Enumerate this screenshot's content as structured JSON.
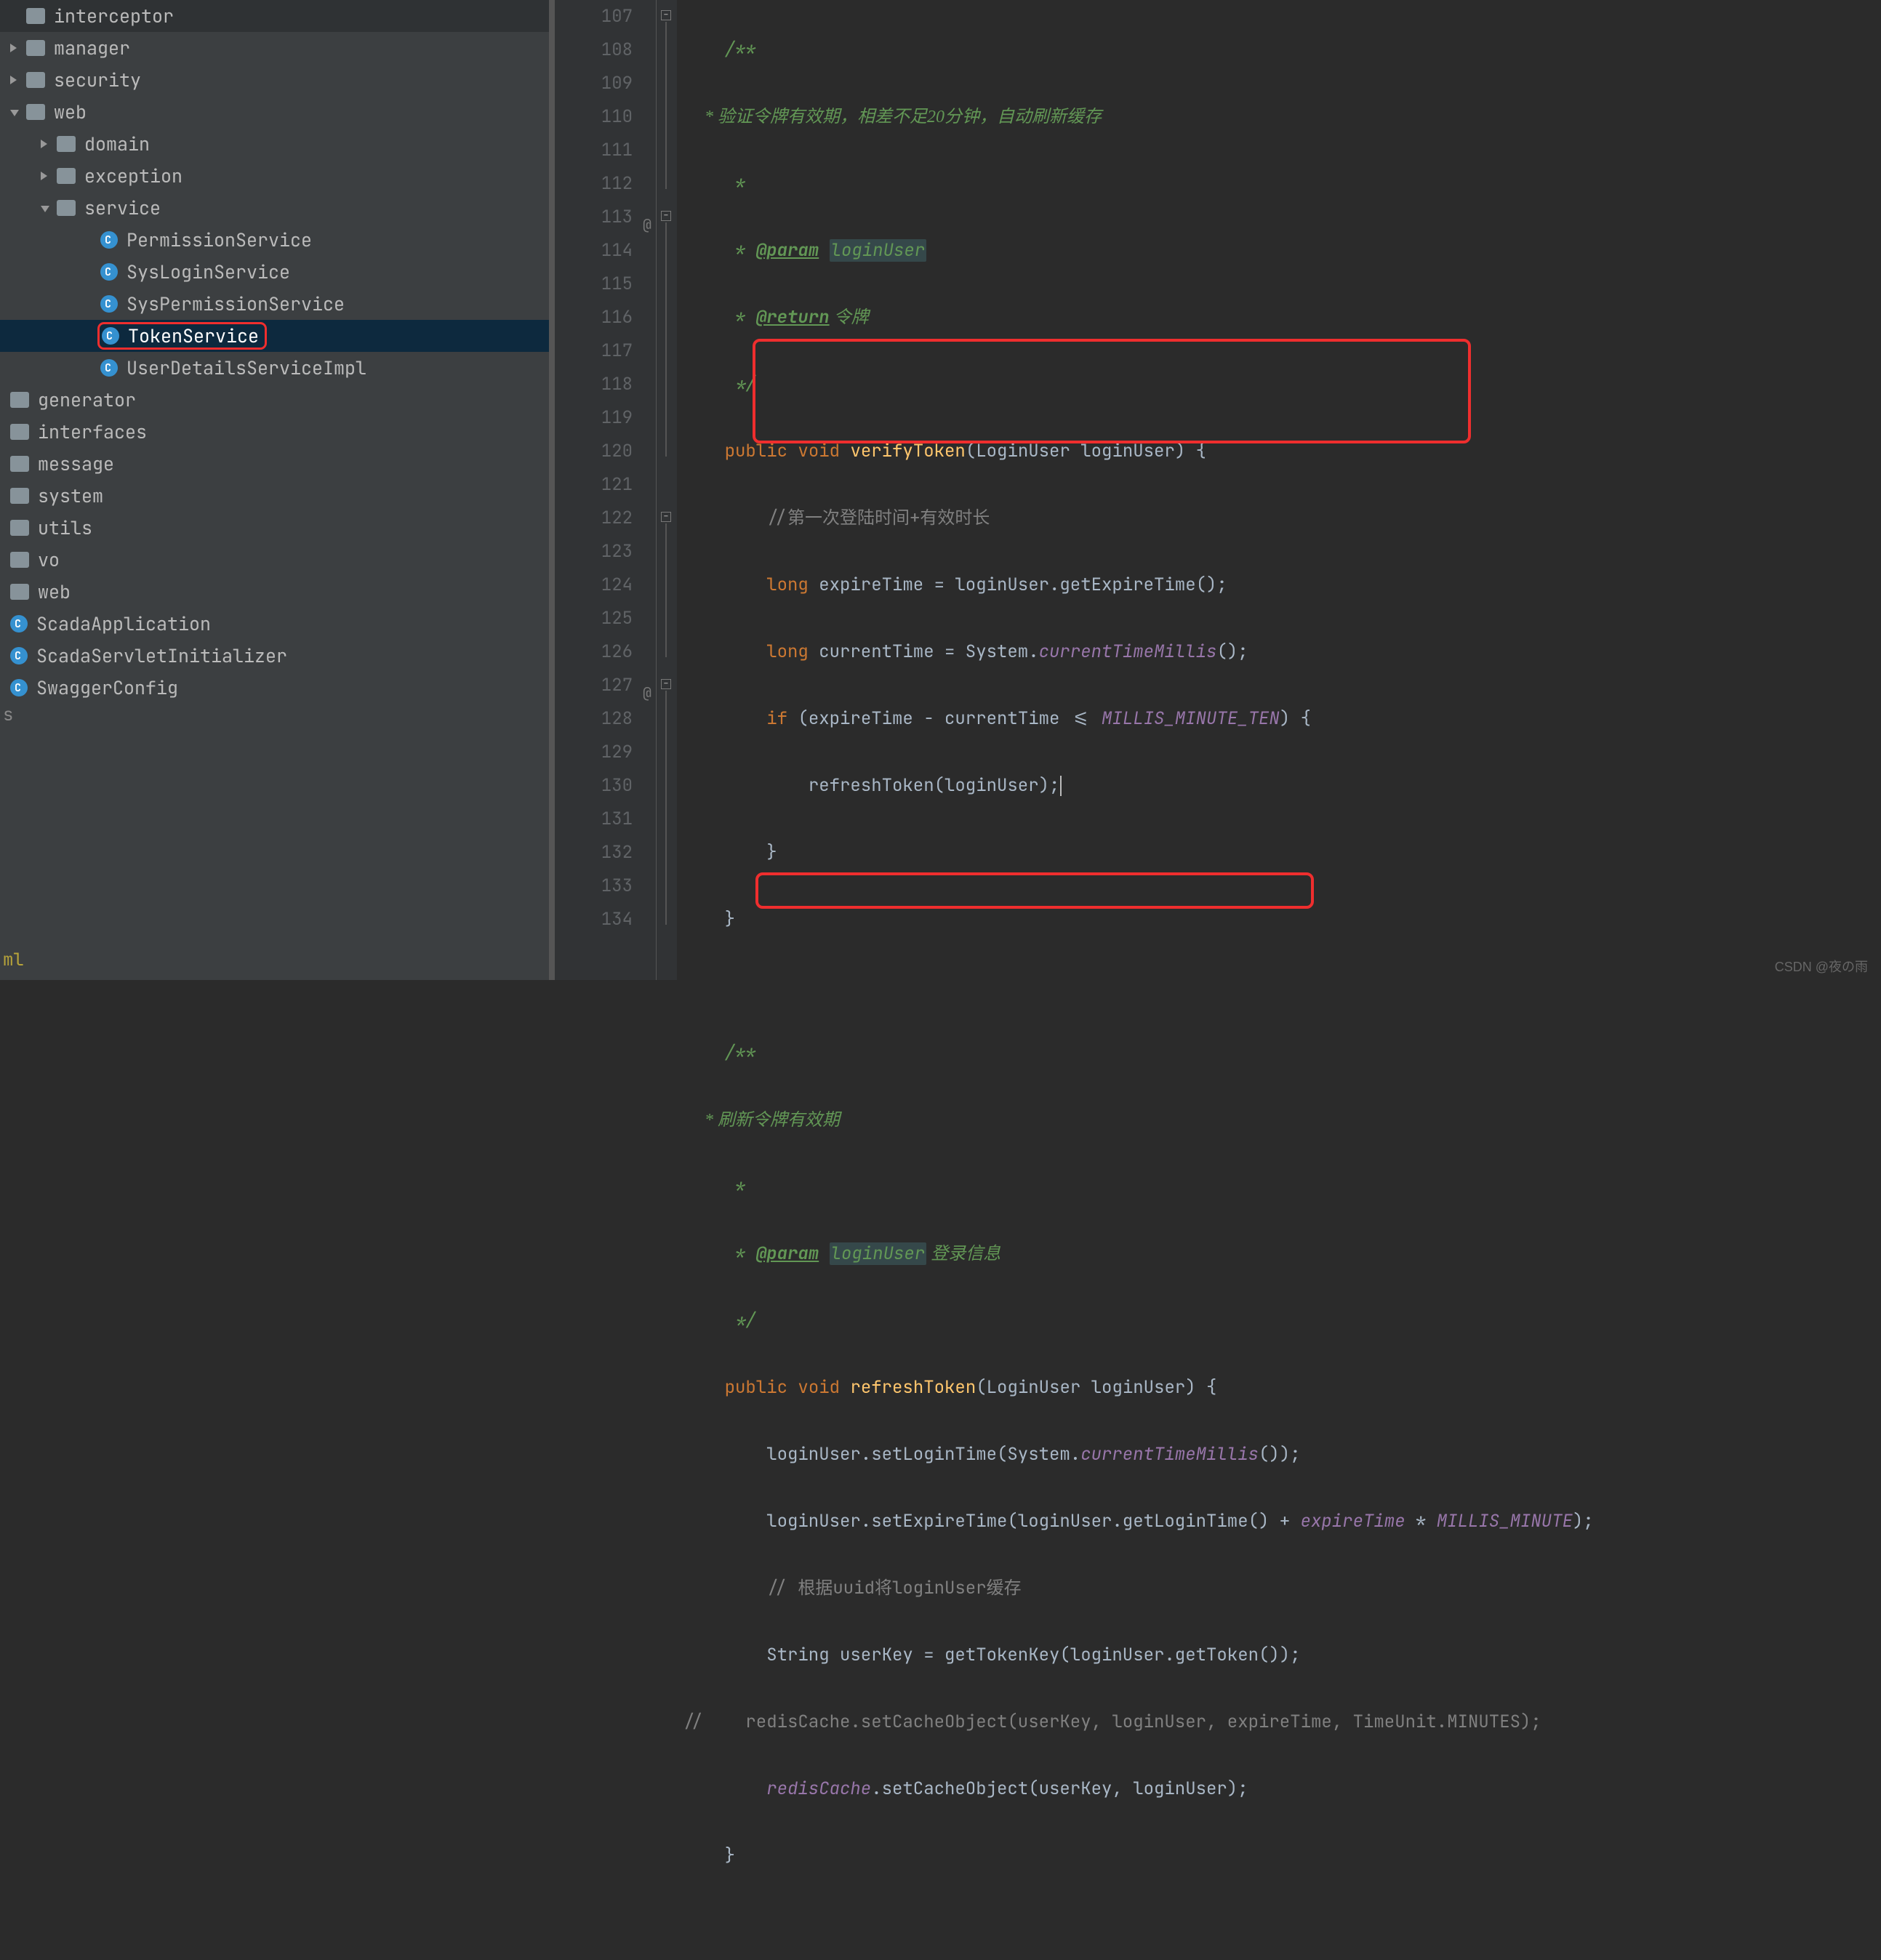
{
  "tree": {
    "l0": [
      "interceptor",
      "manager",
      "security",
      "web"
    ],
    "web_children_root": [
      "domain",
      "exception",
      "service"
    ],
    "service_children": [
      "PermissionService",
      "SysLoginService",
      "SysPermissionService",
      "TokenService",
      "UserDetailsServiceImpl"
    ],
    "l0b": [
      "generator",
      "interfaces",
      "message",
      "system",
      "utils",
      "vo",
      "web"
    ],
    "classes": [
      "ScadaApplication",
      "ScadaServletInitializer",
      "SwaggerConfig"
    ],
    "cut": "s",
    "ml": "ml"
  },
  "gutter": [
    "107",
    "108",
    "109",
    "110",
    "111",
    "112",
    "113",
    "114",
    "115",
    "116",
    "117",
    "118",
    "119",
    "120",
    "121",
    "122",
    "123",
    "124",
    "125",
    "126",
    "127",
    "128",
    "129",
    "130",
    "131",
    "132",
    "133",
    "134"
  ],
  "anno": {
    "113": "@",
    "127": "@"
  },
  "code": {
    "l107": "/**",
    "l108": " * 验证令牌有效期，相差不足20分钟，自动刷新缓存",
    "l109": " *",
    "l110_a": " * ",
    "l110_tag": "@param",
    "l110_b": " ",
    "l110_c": "loginUser",
    "l111_a": " * ",
    "l111_tag": "@return",
    "l111_b": " 令牌",
    "l112": " */",
    "l113_kw1": "public",
    "l113_kw2": "void",
    "l113_name": "verifyToken",
    "l113_sig": "(LoginUser loginUser) {",
    "l114": "//第一次登陆时间+有效时长",
    "l115_kw": "long",
    "l115_rest": " expireTime = loginUser.getExpireTime();",
    "l116_kw": "long",
    "l116_a": " currentTime = System.",
    "l116_m": "currentTimeMillis",
    "l116_b": "();",
    "l117_kw": "if",
    "l117_a": " (expireTime - currentTime <= ",
    "l117_c": "MILLIS_MINUTE_TEN",
    "l117_b": ") {",
    "l118": "refreshToken(loginUser);",
    "l119": "}",
    "l120": "}",
    "l122": "/**",
    "l123": " * 刷新令牌有效期",
    "l124": " *",
    "l125_a": " * ",
    "l125_tag": "@param",
    "l125_b": " ",
    "l125_c": "loginUser",
    "l125_d": " 登录信息",
    "l126": " */",
    "l127_kw1": "public",
    "l127_kw2": "void",
    "l127_name": "refreshToken",
    "l127_sig": "(LoginUser loginUser) {",
    "l128_a": "loginUser.setLoginTime(System.",
    "l128_m": "currentTimeMillis",
    "l128_b": "());",
    "l129_a": "loginUser.setExpireTime(loginUser.getLoginTime() + ",
    "l129_f1": "expireTime",
    "l129_b": " * ",
    "l129_f2": "MILLIS_MINUTE",
    "l129_c": ");",
    "l130": "// 根据uuid将loginUser缓存",
    "l131": "String userKey = getTokenKey(loginUser.getToken());",
    "l132_a": "//",
    "l132_b": "    redisCache.setCacheObject(userKey, loginUser, expireTime, TimeUnit.MINUTES);",
    "l133_a": "redisCache",
    "l133_b": ".setCacheObject(userKey, loginUser);",
    "l134": "}"
  },
  "watermark": "CSDN @夜の雨"
}
